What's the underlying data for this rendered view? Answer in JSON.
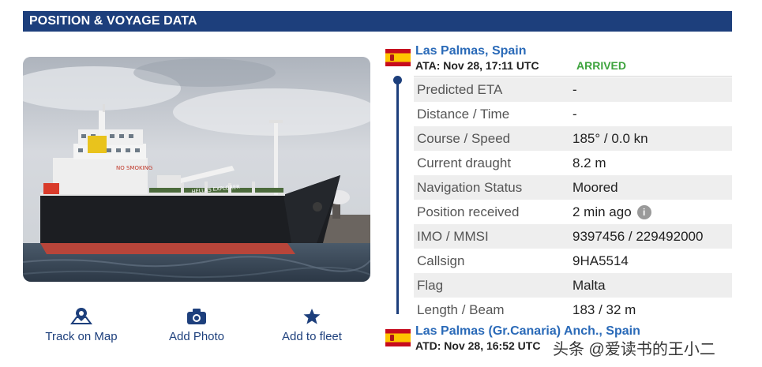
{
  "header": {
    "title": "POSITION & VOYAGE DATA"
  },
  "actions": [
    {
      "label": "Track on Map",
      "icon": "map-pin-icon"
    },
    {
      "label": "Add Photo",
      "icon": "camera-icon"
    },
    {
      "label": "Add to fleet",
      "icon": "star-icon"
    }
  ],
  "arrival": {
    "port": "Las Palmas, Spain",
    "time": "ATA: Nov 28, 17:11 UTC",
    "status": "ARRIVED",
    "flag": "spain-flag-icon",
    "status_color": "#3da33d"
  },
  "departure": {
    "port": "Las Palmas (Gr.Canaria) Anch., Spain",
    "time": "ATD: Nov 28, 16:52 UTC",
    "flag": "spain-flag-icon"
  },
  "rows": [
    {
      "label": "Predicted ETA",
      "value": "-"
    },
    {
      "label": "Distance / Time",
      "value": "-"
    },
    {
      "label": "Course / Speed",
      "value": "185° / 0.0 kn"
    },
    {
      "label": "Current draught",
      "value": "8.2 m"
    },
    {
      "label": "Navigation Status",
      "value": "Moored"
    },
    {
      "label": "Position received",
      "value": "2 min ago"
    },
    {
      "label": "IMO / MMSI",
      "value": "9397456 / 229492000"
    },
    {
      "label": "Callsign",
      "value": "9HA5514"
    },
    {
      "label": "Flag",
      "value": "Malta"
    },
    {
      "label": "Length / Beam",
      "value": "183 / 32 m"
    }
  ],
  "photo": {
    "hull_text": "HELLAS EXPLORER",
    "deck_text": "NO SMOKING"
  },
  "watermark": "头条 @爱读书的王小二",
  "colors": {
    "header_bg": "#1d3f7c",
    "link": "#2a6ab8",
    "accent": "#1d3f7c"
  }
}
